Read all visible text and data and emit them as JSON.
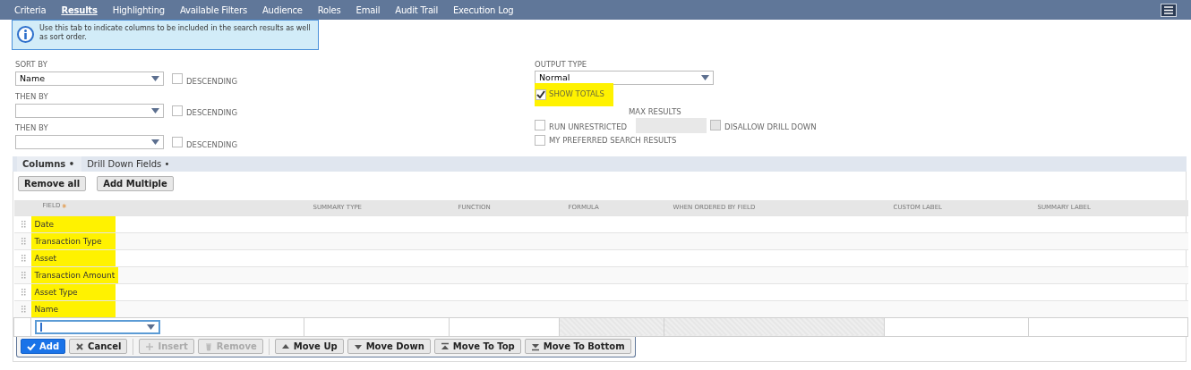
{
  "tabs": [
    {
      "label": "Criteria",
      "selected": false
    },
    {
      "label": "Results",
      "selected": true
    },
    {
      "label": "Highlighting",
      "selected": false
    },
    {
      "label": "Available Filters",
      "selected": false
    },
    {
      "label": "Audience",
      "selected": false
    },
    {
      "label": "Roles",
      "selected": false
    },
    {
      "label": "Email",
      "selected": false
    },
    {
      "label": "Audit Trail",
      "selected": false
    },
    {
      "label": "Execution Log",
      "selected": false
    }
  ],
  "info": "Use this tab to indicate columns to be included in the search results as well as sort order.",
  "sort": [
    {
      "label": "SORT BY",
      "value": "Name",
      "descending_label": "DESCENDING",
      "descending": false
    },
    {
      "label": "THEN BY",
      "descending_label": "DESCENDING",
      "descending": false
    },
    {
      "label": "THEN BY",
      "descending_label": "DESCENDING",
      "descending": false
    }
  ],
  "output_type": {
    "label": "OUTPUT TYPE",
    "value": "Normal"
  },
  "show_totals": {
    "label": "SHOW TOTALS",
    "checked": true,
    "highlighted": true
  },
  "max_results": {
    "label": "MAX RESULTS"
  },
  "run_unrestricted": {
    "label": "RUN UNRESTRICTED",
    "checked": false
  },
  "disallow_drill_down": {
    "label": "DISALLOW DRILL DOWN",
    "checked": false,
    "disabled": true
  },
  "preferred": {
    "label": "MY PREFERRED SEARCH RESULTS",
    "checked": false
  },
  "subtabs": [
    {
      "label": "Columns •",
      "selected": true
    },
    {
      "label": "Drill Down Fields •",
      "selected": false
    }
  ],
  "actions": [
    "Remove all",
    "Add Multiple"
  ],
  "table": {
    "columns": [
      {
        "label": "FIELD",
        "required_mark": "*"
      },
      {
        "label": "SUMMARY TYPE"
      },
      {
        "label": "FUNCTION"
      },
      {
        "label": "FORMULA"
      },
      {
        "label": "WHEN ORDERED BY FIELD"
      },
      {
        "label": "CUSTOM LABEL"
      },
      {
        "label": "SUMMARY LABEL"
      }
    ],
    "rows": [
      {
        "field": "Date",
        "highlighted": true
      },
      {
        "field": "Transaction Type",
        "highlighted": true
      },
      {
        "field": "Asset",
        "highlighted": true
      },
      {
        "field": "Transaction Amount",
        "highlighted": true
      },
      {
        "field": "Asset Type",
        "highlighted": true
      },
      {
        "field": "Name",
        "highlighted": true
      }
    ]
  },
  "edit_buttons": [
    {
      "label": "Add",
      "kind": "add",
      "disabled": false
    },
    {
      "label": "Cancel",
      "kind": "cancel",
      "disabled": false
    },
    {
      "label": "Insert",
      "kind": "insert",
      "disabled": true
    },
    {
      "label": "Remove",
      "kind": "remove",
      "disabled": true
    },
    {
      "label": "Move Up",
      "kind": "up",
      "disabled": false
    },
    {
      "label": "Move Down",
      "kind": "down",
      "disabled": false
    },
    {
      "label": "Move To Top",
      "kind": "top",
      "disabled": false
    },
    {
      "label": "Move To Bottom",
      "kind": "bottom",
      "disabled": false
    }
  ]
}
